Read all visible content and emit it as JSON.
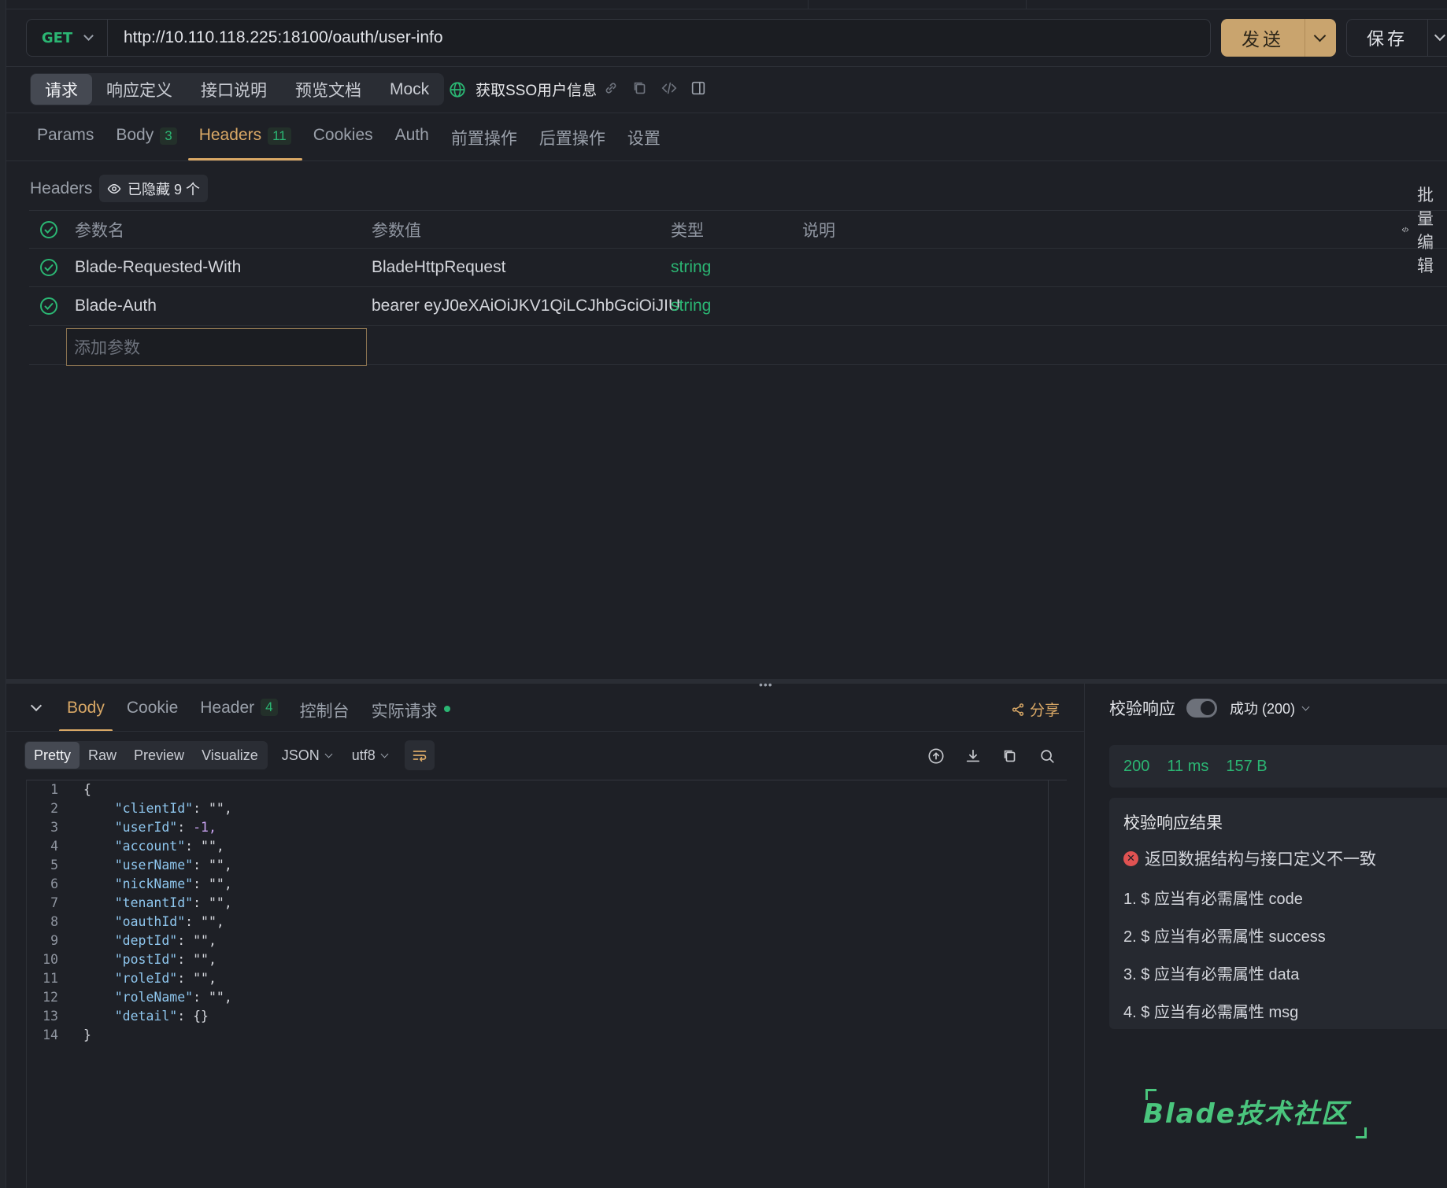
{
  "request": {
    "method": "GET",
    "url": "http://10.110.118.225:18100/oauth/user-info",
    "send_label": "发送",
    "save_label": "保存"
  },
  "mode_tabs": [
    "请求",
    "响应定义",
    "接口说明",
    "预览文档",
    "Mock"
  ],
  "api_name": "获取SSO用户信息",
  "sub_tabs": [
    {
      "label": "Params",
      "count": ""
    },
    {
      "label": "Body",
      "count": "3"
    },
    {
      "label": "Headers",
      "count": "11"
    },
    {
      "label": "Cookies",
      "count": ""
    },
    {
      "label": "Auth",
      "count": ""
    },
    {
      "label": "前置操作",
      "count": ""
    },
    {
      "label": "后置操作",
      "count": ""
    },
    {
      "label": "设置",
      "count": ""
    }
  ],
  "headers_section": {
    "label": "Headers",
    "hidden_chip": "已隐藏 9 个",
    "columns": {
      "name": "参数名",
      "value": "参数值",
      "type": "类型",
      "desc": "说明",
      "bulk": "批量编辑"
    },
    "rows": [
      {
        "name": "Blade-Requested-With",
        "value": "BladeHttpRequest",
        "type": "string"
      },
      {
        "name": "Blade-Auth",
        "value": "bearer eyJ0eXAiOiJKV1QiLCJhbGciOiJIU",
        "type": "string"
      }
    ],
    "add_placeholder": "添加参数"
  },
  "response": {
    "tabs": [
      {
        "label": "Body",
        "count": ""
      },
      {
        "label": "Cookie",
        "count": ""
      },
      {
        "label": "Header",
        "count": "4"
      },
      {
        "label": "控制台",
        "count": ""
      },
      {
        "label": "实际请求",
        "count": ""
      }
    ],
    "share_label": "分享",
    "formats": [
      "Pretty",
      "Raw",
      "Preview",
      "Visualize"
    ],
    "lang": "JSON",
    "encoding": "utf8",
    "code_lines": [
      "{",
      "    \"clientId\": \"\",",
      "    \"userId\": -1,",
      "    \"account\": \"\",",
      "    \"userName\": \"\",",
      "    \"nickName\": \"\",",
      "    \"tenantId\": \"\",",
      "    \"oauthId\": \"\",",
      "    \"deptId\": \"\",",
      "    \"postId\": \"\",",
      "    \"roleId\": \"\",",
      "    \"roleName\": \"\",",
      "    \"detail\": {}",
      "}"
    ]
  },
  "validation": {
    "title": "校验响应",
    "status": "成功 (200)",
    "code": "200",
    "time": "11 ms",
    "size": "157 B",
    "result_title": "校验响应结果",
    "error": "返回数据结构与接口定义不一致",
    "items": [
      "1. $ 应当有必需属性 code",
      "2. $ 应当有必需属性 success",
      "3. $ 应当有必需属性 data",
      "4. $ 应当有必需属性 msg"
    ]
  },
  "watermark": "Blade技术社区",
  "colors": {
    "accent": "#d9a866",
    "success": "#2bb673",
    "send_bg": "#c9a46e",
    "error": "#e05252"
  }
}
